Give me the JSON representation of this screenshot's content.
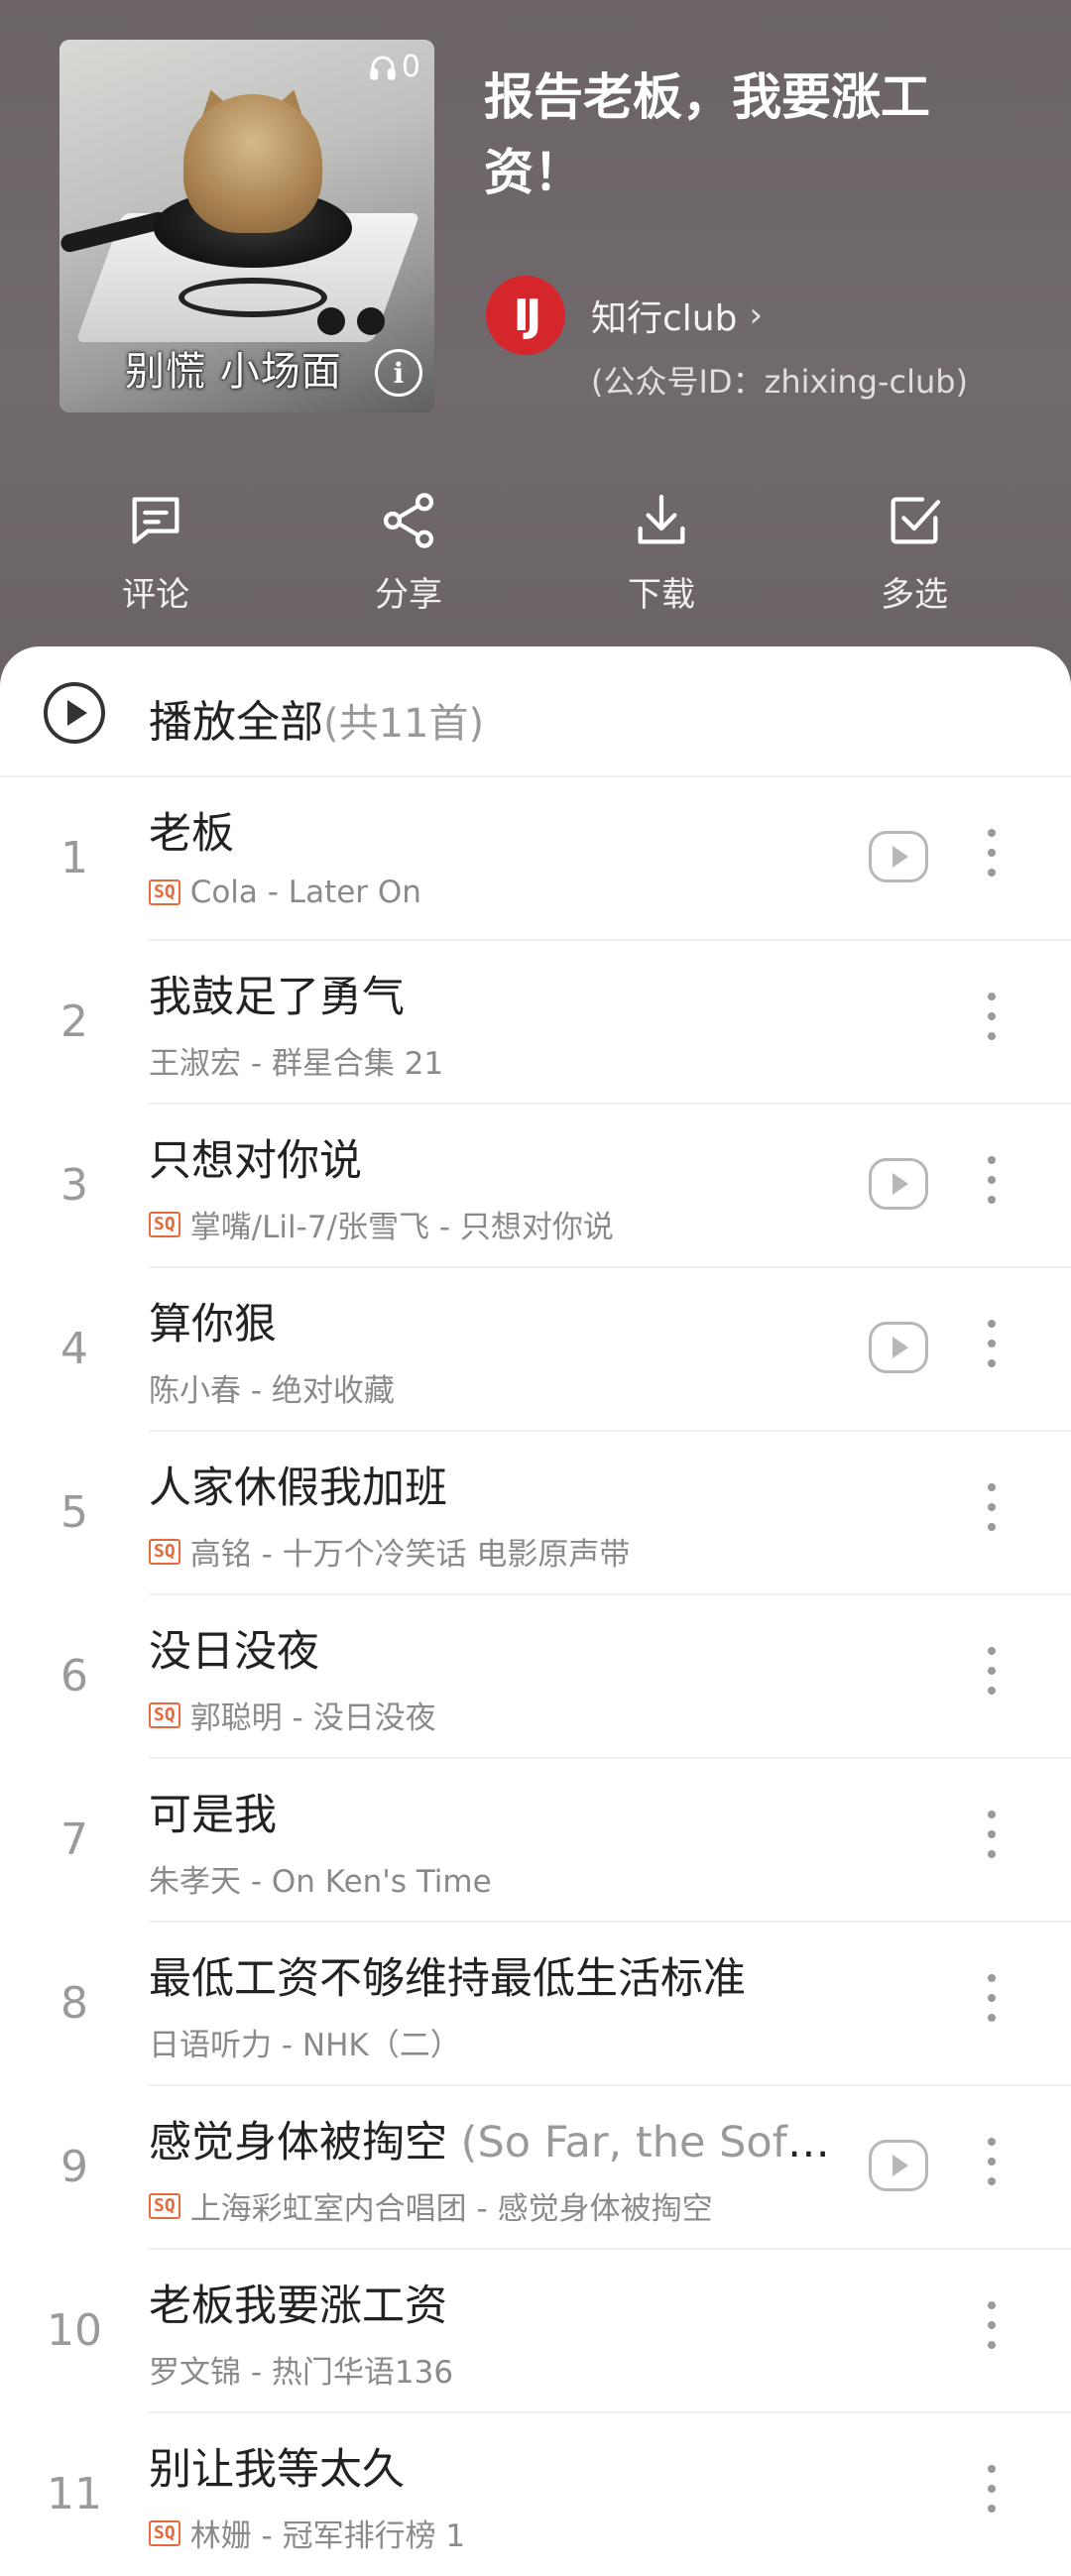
{
  "playlist": {
    "title": "报告老板，我要涨工资！",
    "play_count": "0",
    "cover_caption": "别慌 小场面",
    "creator": {
      "avatar_text": "IJ",
      "name": "知行club",
      "id_text": "(公众号ID：zhixing-club)"
    }
  },
  "actions": [
    {
      "label": "评论",
      "icon": "comment-icon"
    },
    {
      "label": "分享",
      "icon": "share-icon"
    },
    {
      "label": "下载",
      "icon": "download-icon"
    },
    {
      "label": "多选",
      "icon": "multiselect-icon"
    }
  ],
  "play_all": {
    "label": "播放全部",
    "count": "(共11首)"
  },
  "badge_sq": "SQ",
  "songs": [
    {
      "index": "1",
      "title": "老板",
      "extra": "",
      "subtitle": "Cola - Later On",
      "sq": true,
      "mv": true
    },
    {
      "index": "2",
      "title": "我鼓足了勇气",
      "extra": "",
      "subtitle": "王淑宏 - 群星合集 21",
      "sq": false,
      "mv": false
    },
    {
      "index": "3",
      "title": "只想对你说",
      "extra": "",
      "subtitle": "掌嘴/Lil-7/张雪飞 - 只想对你说",
      "sq": true,
      "mv": true
    },
    {
      "index": "4",
      "title": "算你狠",
      "extra": "",
      "subtitle": "陈小春 - 绝对收藏",
      "sq": false,
      "mv": true
    },
    {
      "index": "5",
      "title": "人家休假我加班",
      "extra": "",
      "subtitle": "高铭 - 十万个冷笑话 电影原声带",
      "sq": true,
      "mv": false
    },
    {
      "index": "6",
      "title": "没日没夜",
      "extra": "",
      "subtitle": "郭聪明 - 没日没夜",
      "sq": true,
      "mv": false
    },
    {
      "index": "7",
      "title": "可是我",
      "extra": "",
      "subtitle": "朱孝天 - On Ken's Time",
      "sq": false,
      "mv": false
    },
    {
      "index": "8",
      "title": "最低工资不够维持最低生活标准",
      "extra": "",
      "subtitle": "日语听力 - NHK（二）",
      "sq": false,
      "mv": false
    },
    {
      "index": "9",
      "title": "感觉身体被掏空",
      "extra": " (So Far, the Sofa...",
      "subtitle": "上海彩虹室内合唱团 - 感觉身体被掏空",
      "sq": true,
      "mv": true
    },
    {
      "index": "10",
      "title": "老板我要涨工资",
      "extra": "",
      "subtitle": "罗文锦 - 热门华语136",
      "sq": false,
      "mv": false
    },
    {
      "index": "11",
      "title": "别让我等太久",
      "extra": "",
      "subtitle": "林姗 - 冠军排行榜 1",
      "sq": true,
      "mv": false
    }
  ]
}
